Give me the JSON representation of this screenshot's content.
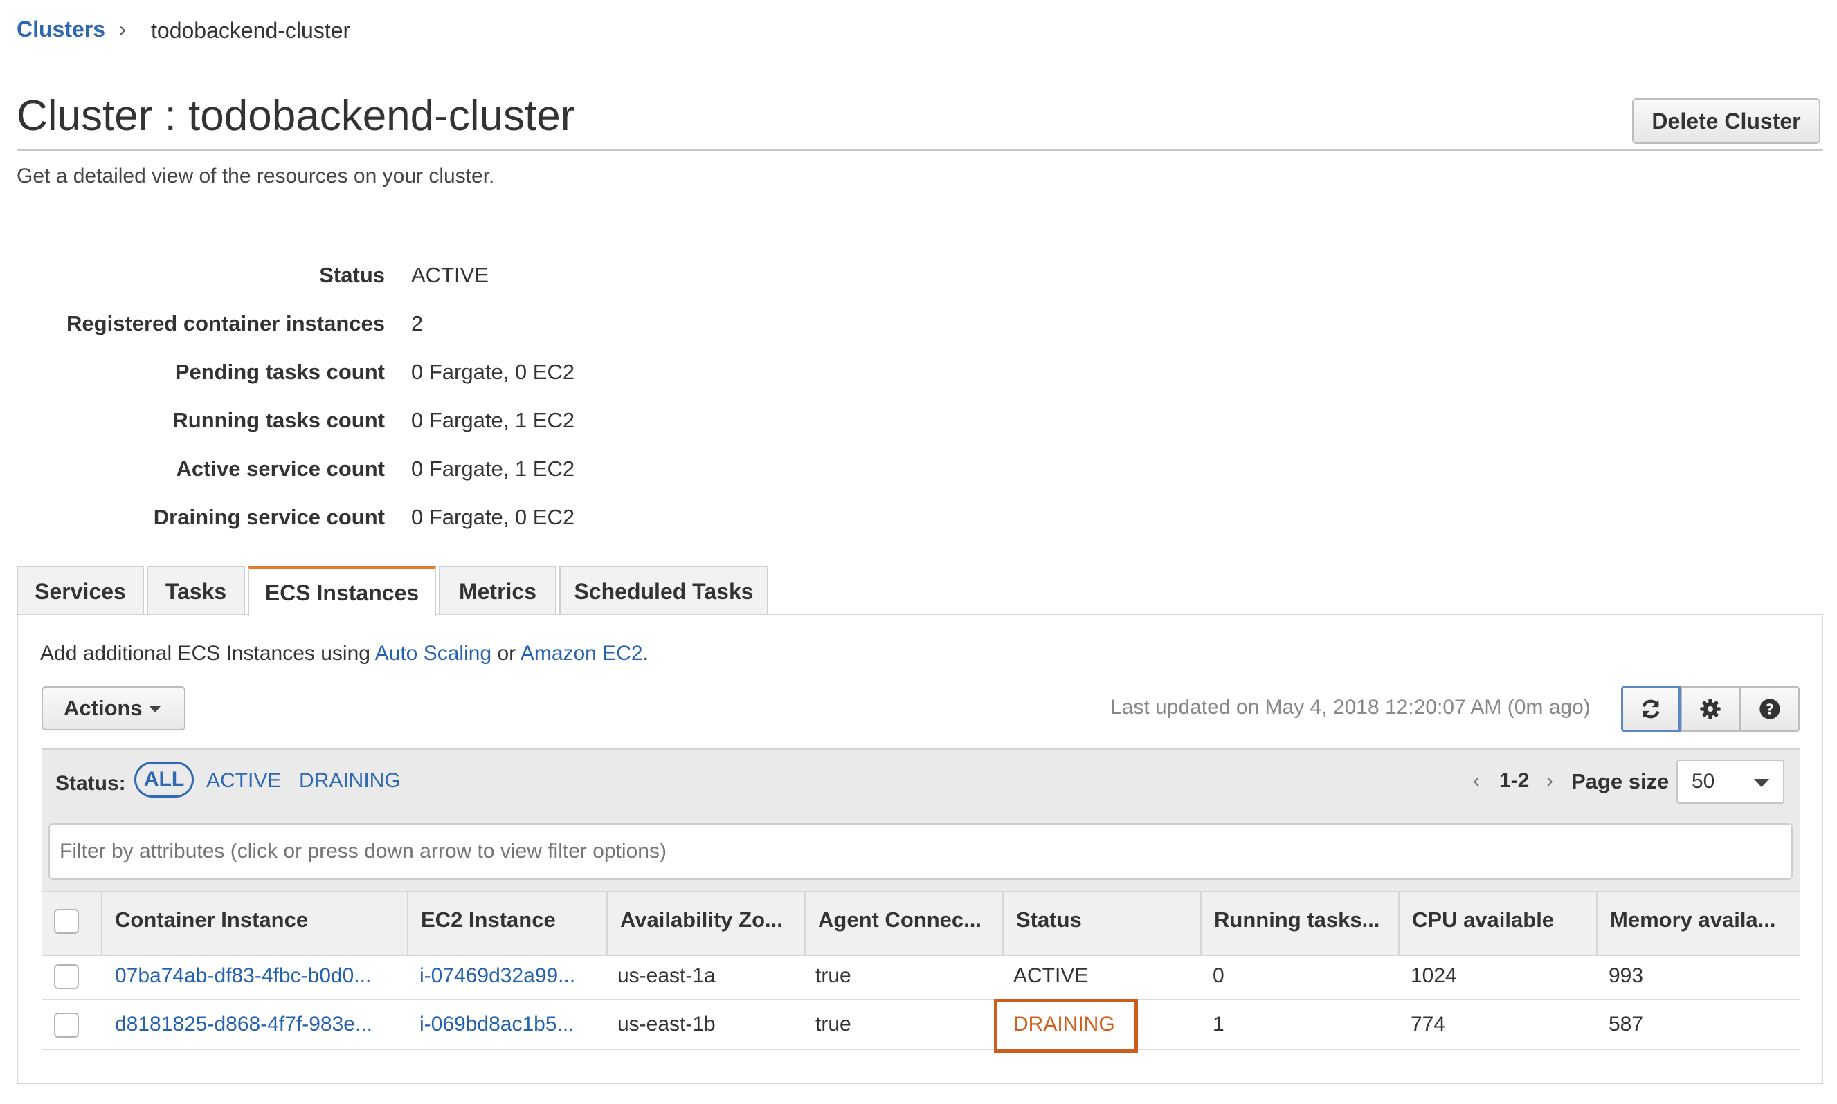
{
  "breadcrumb": {
    "root": "Clusters",
    "separator": "›",
    "current": "todobackend-cluster"
  },
  "header": {
    "title": "Cluster : todobackend-cluster",
    "delete_label": "Delete Cluster",
    "subtitle": "Get a detailed view of the resources on your cluster."
  },
  "details": [
    {
      "key": "Status",
      "value": "ACTIVE"
    },
    {
      "key": "Registered container instances",
      "value": "2"
    },
    {
      "key": "Pending tasks count",
      "value": "0 Fargate, 0 EC2"
    },
    {
      "key": "Running tasks count",
      "value": "0 Fargate, 1 EC2"
    },
    {
      "key": "Active service count",
      "value": "0 Fargate, 1 EC2"
    },
    {
      "key": "Draining service count",
      "value": "0 Fargate, 0 EC2"
    }
  ],
  "tabs": [
    {
      "label": "Services"
    },
    {
      "label": "Tasks"
    },
    {
      "label": "ECS Instances",
      "active": true
    },
    {
      "label": "Metrics"
    },
    {
      "label": "Scheduled Tasks"
    }
  ],
  "panel": {
    "info_prefix": "Add additional ECS Instances using ",
    "info_link1": "Auto Scaling",
    "info_mid": " or ",
    "info_link2": "Amazon EC2",
    "info_suffix": ".",
    "actions_label": "Actions",
    "last_updated": "Last updated on May 4, 2018 12:20:07 AM (0m ago)",
    "icons": {
      "refresh": "refresh-icon",
      "settings": "gear-icon",
      "help": "help-icon"
    }
  },
  "status_filter": {
    "label": "Status:",
    "options": [
      "ALL",
      "ACTIVE",
      "DRAINING"
    ],
    "selected": "ALL"
  },
  "pagination": {
    "prev": "‹",
    "range": "1-2",
    "next": "›",
    "page_size_label": "Page size",
    "page_size": "50"
  },
  "filter": {
    "placeholder": "Filter by attributes (click or press down arrow to view filter options)"
  },
  "table": {
    "columns": [
      "Container Instance",
      "EC2 Instance",
      "Availability Zo...",
      "Agent Connec...",
      "Status",
      "Running tasks...",
      "CPU available",
      "Memory availa..."
    ],
    "rows": [
      [
        "07ba74ab-df83-4fbc-b0d0...",
        "i-07469d32a99...",
        "us-east-1a",
        "true",
        "ACTIVE",
        "0",
        "1024",
        "993"
      ],
      [
        "d8181825-d868-4f7f-983e...",
        "i-069bd8ac1b5...",
        "us-east-1b",
        "true",
        "DRAINING",
        "1",
        "774",
        "587"
      ]
    ]
  },
  "colors": {
    "link": "#2462b1",
    "tab_accent": "#e07b30",
    "highlight": "#cd5d1c",
    "draining_text": "#d35d1b"
  }
}
